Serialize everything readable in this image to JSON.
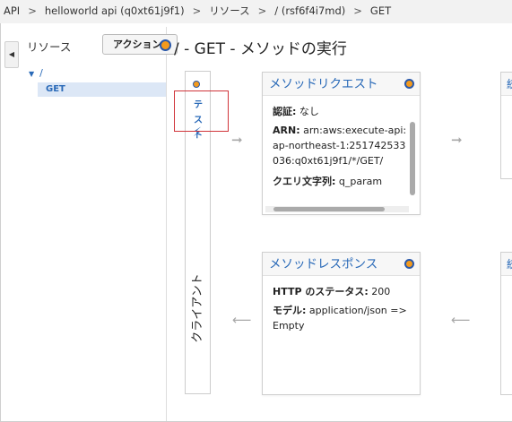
{
  "breadcrumb": {
    "items": [
      "API",
      "helloworld api (q0xt61j9f1)",
      "リソース",
      "/ (rsf6f4i7md)",
      "GET"
    ],
    "separator": ">"
  },
  "sidebar": {
    "collapse_glyph": "◀",
    "title": "リソース",
    "action_button": "アクション▾",
    "tree": {
      "root_caret": "▼",
      "root": "/",
      "selected_method": "GET"
    }
  },
  "main": {
    "title": "/ - GET - メソッドの実行"
  },
  "client": {
    "test_label": "テスト",
    "bolt_icon": "⚡",
    "label": "クライアント"
  },
  "method_request": {
    "title": "メソッドリクエスト",
    "auth_label": "認証:",
    "auth_value": "なし",
    "arn_label": "ARN:",
    "arn_value": "arn:aws:execute-api:ap-northeast-1:251742533036:q0xt61j9f1/*/GET/",
    "query_label": "クエリ文字列:",
    "query_value": "q_param"
  },
  "method_response": {
    "title": "メソッドレスポンス",
    "status_label": "HTTP のステータス:",
    "status_value": "200",
    "model_label": "モデル:",
    "model_value": "application/json => Empty"
  },
  "integration_request": {
    "title_fragment": "統"
  },
  "integration_response": {
    "title_fragment": "統"
  },
  "arrow_right": "➞",
  "arrow_left": "⟵",
  "colors": {
    "accent": "#2a6ab8",
    "dot_fill": "#f39a1d",
    "highlight": "#d0343a"
  }
}
